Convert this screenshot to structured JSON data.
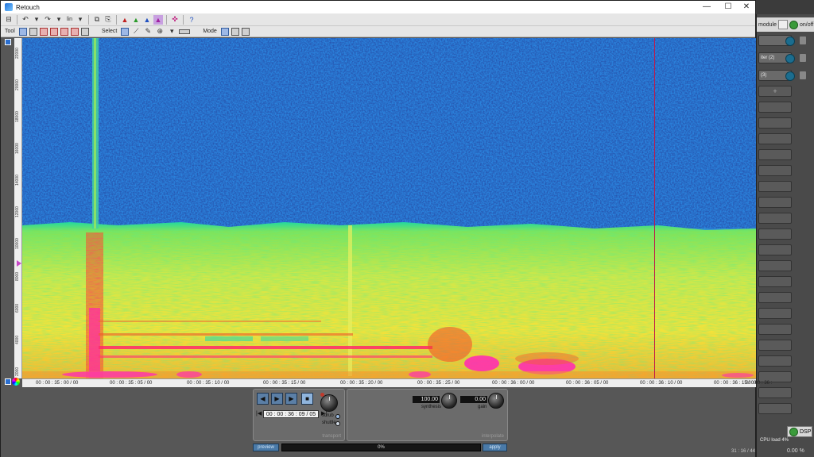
{
  "window": {
    "title": "Retouch",
    "minimize": "—",
    "maximize": "☐",
    "close": "✕"
  },
  "toolbar1": {
    "zoom_mode": "lin"
  },
  "toolbar2": {
    "tool_label": "Tool",
    "select_label": "Select",
    "mode_label": "Mode"
  },
  "vruler": {
    "ticks": [
      "22000",
      "20000",
      "18000",
      "16000",
      "14000",
      "12000",
      "10000",
      "8000",
      "6000",
      "4000",
      "2000"
    ]
  },
  "hruler": {
    "ticks": [
      "00 : 00 : 35 : 00 / 00",
      "00 : 00 : 35 : 05 / 00",
      "00 : 00 : 35 : 10 / 00",
      "00 : 00 : 35 : 15 / 00",
      "00 : 00 : 35 : 20 / 00",
      "00 : 00 : 35 : 25 / 00",
      "00 : 00 : 36 : 00 / 00",
      "00 : 00 : 36 : 05 / 00",
      "00 : 00 : 36 : 10 / 00",
      "00 : 00 : 36 : 15 / 00",
      "00 : 00 : 36 :"
    ]
  },
  "transport": {
    "title": "transport",
    "timecode": "00 : 00 : 36 : 09 / 05",
    "scrub": "scrub",
    "shuttle": "shuttle",
    "prev": "|◀",
    "next": "▶|"
  },
  "interpolate": {
    "title": "interpolate",
    "synthesis_value": "100.00",
    "synthesis_label": "synthesis",
    "gain_value": "0.00",
    "gain_label": "gain"
  },
  "bottom": {
    "preview": "preview",
    "progress": "0%",
    "progress_fraction": 0,
    "apply": "apply"
  },
  "host": {
    "module_label": "module",
    "onoff": "on/off",
    "slot1": "iter (2)",
    "slot2": "(3)",
    "add": "+",
    "dsp": "DSP",
    "cpu_load": "CPU load 4%",
    "percent": "0.00 %",
    "time": "31 : 16 / 44"
  }
}
